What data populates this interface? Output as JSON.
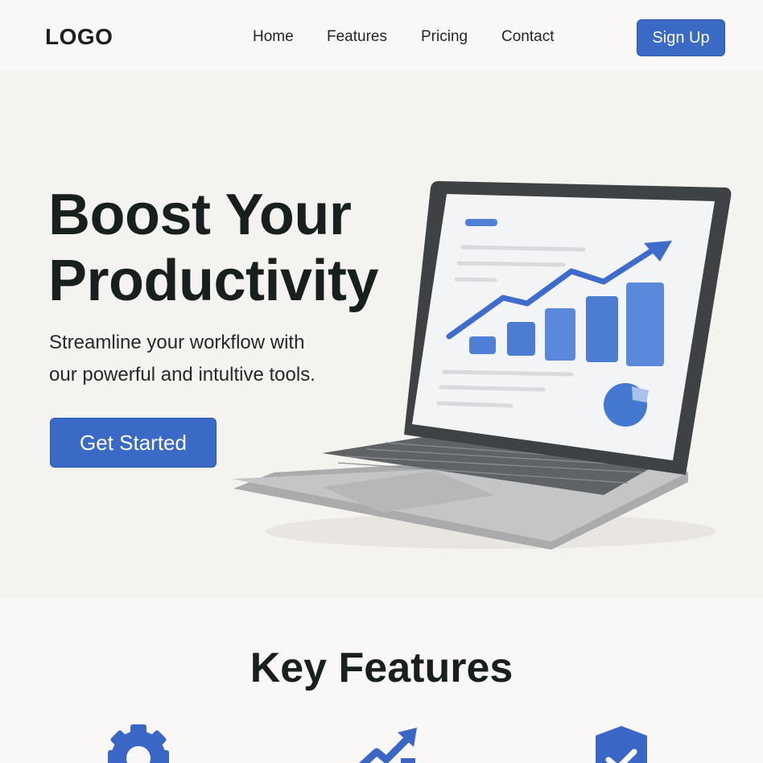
{
  "header": {
    "logo": "LOGO",
    "nav": [
      "Home",
      "Features",
      "Pricing",
      "Contact"
    ],
    "signup_label": "Sign Up"
  },
  "hero": {
    "title_line1": "Boost Your",
    "title_line2": "Productivity",
    "subtitle_line1": "Streamline your workflow with",
    "subtitle_line2": "our powerful and intultive tools.",
    "cta_label": "Get Started",
    "illustration_icon": "laptop-with-growth-chart-icon"
  },
  "features": {
    "title": "Key Features",
    "icons": [
      "gear-icon",
      "growth-chart-icon",
      "shield-check-icon"
    ]
  },
  "colors": {
    "accent": "#3b69c6",
    "background": "#f5f3f0",
    "text": "#17201f"
  }
}
